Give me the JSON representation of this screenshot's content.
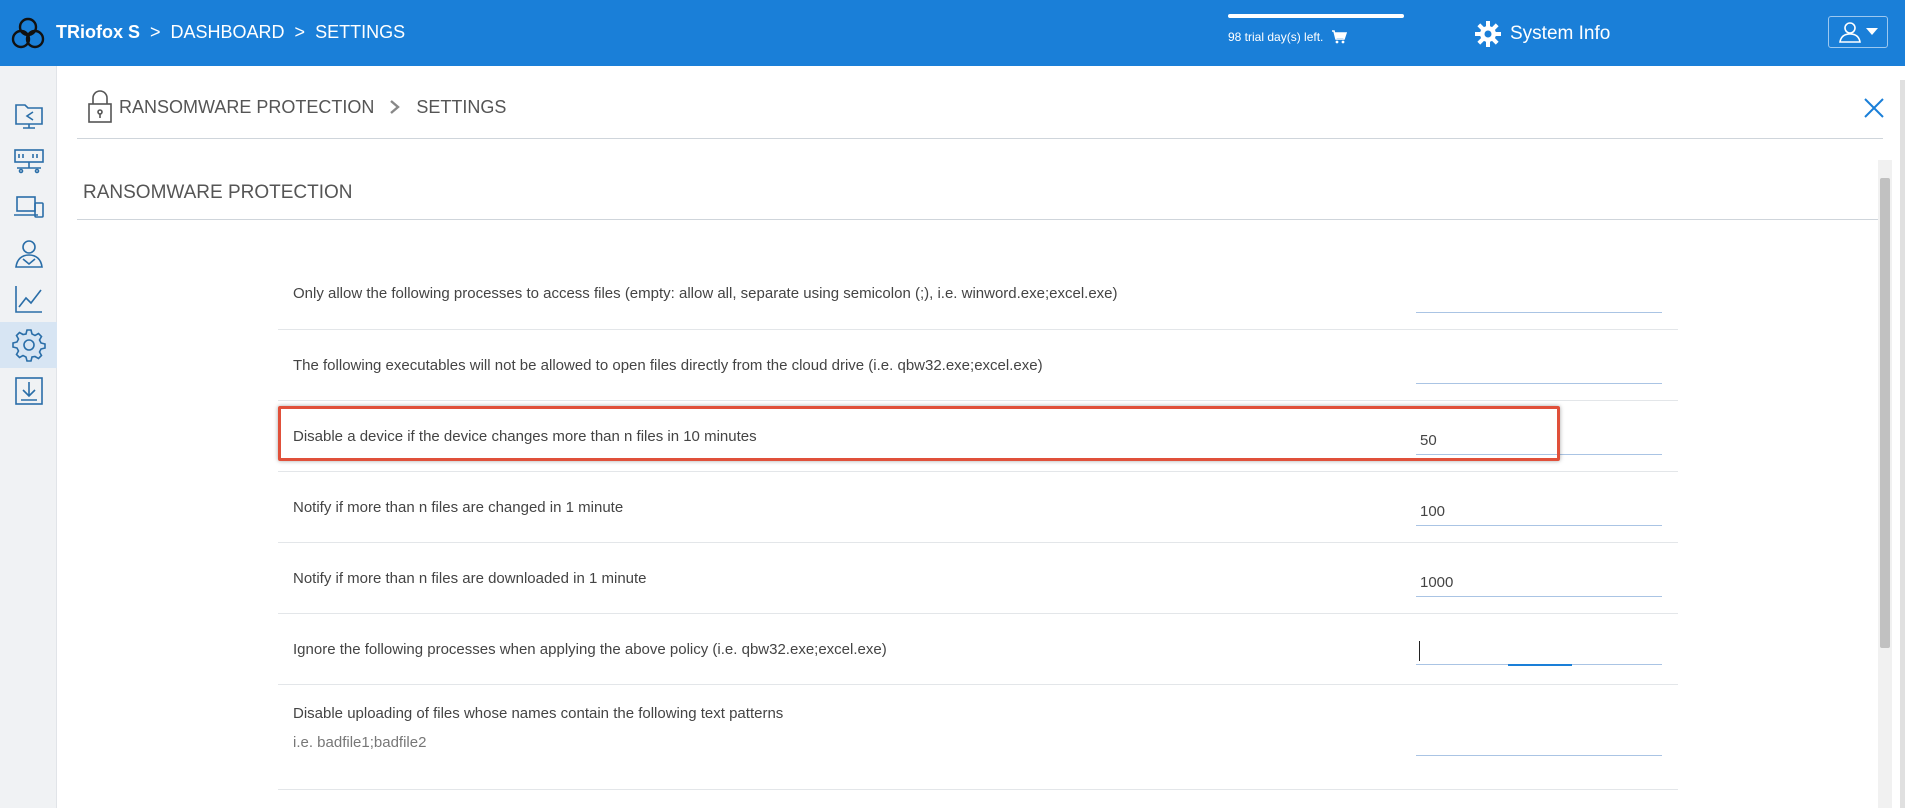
{
  "header": {
    "app_name": "TRiofox S",
    "crumb_dashboard": "DASHBOARD",
    "crumb_settings": "SETTINGS",
    "separator": ">",
    "trial_text": "98 trial day(s) left.",
    "trial_progress": 1.0,
    "system_info": "System Info"
  },
  "sidebar": {
    "items": [
      {
        "name": "file-share",
        "icon": "folder-share-icon"
      },
      {
        "name": "servers",
        "icon": "server-icon"
      },
      {
        "name": "devices",
        "icon": "devices-icon"
      },
      {
        "name": "users",
        "icon": "users-icon"
      },
      {
        "name": "reports",
        "icon": "chart-icon"
      },
      {
        "name": "settings",
        "icon": "gear-icon",
        "active": true
      },
      {
        "name": "downloads",
        "icon": "download-icon"
      }
    ]
  },
  "breadcrumb": {
    "root": "RANSOMWARE PROTECTION",
    "current": "SETTINGS"
  },
  "section": {
    "title": "RANSOMWARE PROTECTION"
  },
  "settings": [
    {
      "label": "Only allow the following processes to access files (empty: allow all, separate using semicolon (;), i.e. winword.exe;excel.exe)",
      "value": ""
    },
    {
      "label": "The following executables will not be allowed to open files directly from the cloud drive (i.e. qbw32.exe;excel.exe)",
      "value": ""
    },
    {
      "label": "Disable a device if the device changes more than n files in 10 minutes",
      "value": "50"
    },
    {
      "label": "Notify if more than n files are changed in 1 minute",
      "value": "100"
    },
    {
      "label": "Notify if more than n files are downloaded in 1 minute",
      "value": "1000"
    },
    {
      "label": "Ignore the following processes when applying the above policy (i.e. qbw32.exe;excel.exe)",
      "value": ""
    },
    {
      "label": "Disable uploading of files whose names contain the following text patterns",
      "sub": "i.e. badfile1;badfile2",
      "value": ""
    }
  ],
  "colors": {
    "header_bg": "#1a7fd8",
    "highlight": "#e0503a"
  }
}
